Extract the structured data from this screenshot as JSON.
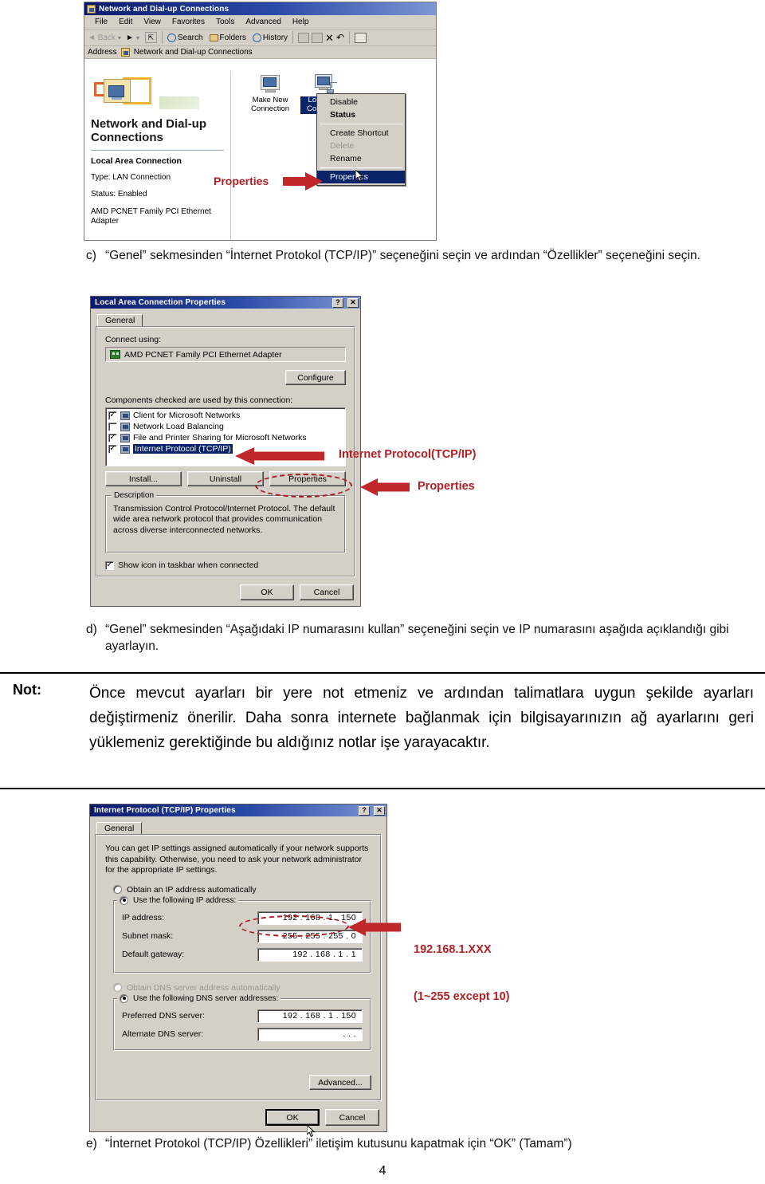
{
  "page": {
    "number": "4"
  },
  "figure1": {
    "name": "network-and-dialup-connections-window",
    "title": "Network and Dial-up Connections",
    "title_icon": "network-folder-icon",
    "titlebar_buttons": [],
    "menu": [
      "File",
      "Edit",
      "View",
      "Favorites",
      "Tools",
      "Advanced",
      "Help"
    ],
    "toolbar": {
      "back": "Back",
      "forward": "",
      "up_icon": "up-folder-icon",
      "search": "Search",
      "folders": "Folders",
      "history": "History",
      "move_to_icon": "move-to-icon",
      "copy_to_icon": "copy-to-icon",
      "delete_icon": "delete-x-icon",
      "undo_icon": "undo-icon",
      "views_icon": "views-icon"
    },
    "address": {
      "label": "Address",
      "icon": "network-folder-icon",
      "value": "Network and Dial-up Connections"
    },
    "sidebar": {
      "heading": "Network and Dial-up Connections",
      "item_name": "Local Area Connection",
      "lines": [
        "Type: LAN Connection",
        "Status: Enabled",
        "AMD PCNET Family PCI Ethernet Adapter"
      ]
    },
    "icons": [
      {
        "label": "Make New Connection",
        "icon": "make-new-connection-icon",
        "selected": false
      },
      {
        "label": "Local Area Connection",
        "icon": "local-area-connection-icon",
        "selected": true
      }
    ],
    "context_menu": [
      {
        "label": "Disable",
        "bold": false,
        "disabled": false,
        "highlighted": false
      },
      {
        "label": "Status",
        "bold": true,
        "disabled": false,
        "highlighted": false
      },
      {
        "label": "Create Shortcut",
        "bold": false,
        "disabled": false,
        "highlighted": false
      },
      {
        "label": "Delete",
        "bold": false,
        "disabled": true,
        "highlighted": false
      },
      {
        "label": "Rename",
        "bold": false,
        "disabled": false,
        "highlighted": false
      },
      {
        "label": "Properties",
        "bold": false,
        "disabled": false,
        "highlighted": true
      }
    ],
    "annotation": "Properties",
    "annotation_color": "#b01f24",
    "cursor": "mouse-pointer"
  },
  "step_c": {
    "marker": "c)",
    "text": "“Genel” sekmesinden “İnternet Protokol (TCP/IP)” seçeneğini seçin ve ardından “Özellikler” seçeneğini seçin."
  },
  "figure2": {
    "name": "local-area-connection-properties-dialog",
    "title": "Local Area Connection Properties",
    "help_btn": "?",
    "close_btn": "✕",
    "tab": "General",
    "connect_using_label": "Connect using:",
    "adapter": "AMD PCNET Family PCI Ethernet Adapter",
    "adapter_icon": "nic-card-icon",
    "configure_btn": "Configure",
    "components_label": "Components checked are used by this connection:",
    "components": [
      {
        "label": "Client for Microsoft Networks",
        "checked": true,
        "selected": false,
        "icon": "client-icon"
      },
      {
        "label": "Network Load Balancing",
        "checked": false,
        "selected": false,
        "icon": "service-icon"
      },
      {
        "label": "File and Printer Sharing for Microsoft Networks",
        "checked": true,
        "selected": false,
        "icon": "service-icon"
      },
      {
        "label": "Internet Protocol (TCP/IP)",
        "checked": true,
        "selected": true,
        "icon": "protocol-icon"
      }
    ],
    "buttons": {
      "install": "Install...",
      "uninstall": "Uninstall",
      "properties": "Properties"
    },
    "description_title": "Description",
    "description": "Transmission Control Protocol/Internet Protocol. The default wide area network protocol that provides communication across diverse interconnected networks.",
    "taskbar_checkbox": {
      "label": "Show icon in taskbar when connected",
      "checked": true
    },
    "ok": "OK",
    "cancel": "Cancel",
    "annotations": [
      {
        "text": "Internet Protocol(TCP/IP)",
        "target": "component-tcpip"
      },
      {
        "text": "Properties",
        "target": "properties-button"
      }
    ],
    "annotation_color": "#b01f24"
  },
  "step_d": {
    "marker": "d)",
    "text": "“Genel” sekmesinden “Aşağıdaki IP numarasını kullan” seçeneğini seçin ve IP numarasını aşağıda açıklandığı gibi ayarlayın."
  },
  "note": {
    "label": "Not:",
    "text": "Önce mevcut ayarları bir yere not etmeniz ve ardından talimatlara uygun şekilde ayarları değiştirmeniz önerilir. Daha sonra internete bağlanmak için bilgisayarınızın ağ ayarlarını geri yüklemeniz gerektiğinde bu aldığınız notlar işe yarayacaktır."
  },
  "figure3": {
    "name": "internet-protocol-tcpip-properties-dialog",
    "title": "Internet Protocol (TCP/IP) Properties",
    "help_btn": "?",
    "close_btn": "✕",
    "tab": "General",
    "intro": "You can get IP settings assigned automatically if your network supports this capability. Otherwise, you need to ask your network administrator for the appropriate IP settings.",
    "radio_auto_ip": {
      "label": "Obtain an IP address automatically",
      "selected": false
    },
    "radio_manual_ip": {
      "label": "Use the following IP address:",
      "selected": true
    },
    "fields": [
      {
        "label": "IP address:",
        "value": "192 . 168 .  1  . 150",
        "highlighted": true
      },
      {
        "label": "Subnet mask:",
        "value": "255 . 255 . 255 .  0",
        "highlighted": false
      },
      {
        "label": "Default gateway:",
        "value": "192 . 168 .  1  .  1",
        "highlighted": false
      }
    ],
    "radio_auto_dns": {
      "label": "Obtain DNS server address automatically",
      "selected": false,
      "disabled": true
    },
    "radio_manual_dns": {
      "label": "Use the following DNS server addresses:",
      "selected": true
    },
    "dns_fields": [
      {
        "label": "Preferred DNS server:",
        "value": "192 . 168 .  1  . 150"
      },
      {
        "label": "Alternate DNS server:",
        "value": ".      .      ."
      }
    ],
    "advanced_btn": "Advanced...",
    "ok": "OK",
    "cancel": "Cancel",
    "annotation_line1": "192.168.1.XXX",
    "annotation_line2": "(1~255 except 10)",
    "annotation_color": "#b01f24"
  },
  "step_e": {
    "marker": "e)",
    "text": "“İnternet Protokol (TCP/IP) Özellikleri” iletişim kutusunu kapatmak için “OK” (Tamam”)"
  }
}
